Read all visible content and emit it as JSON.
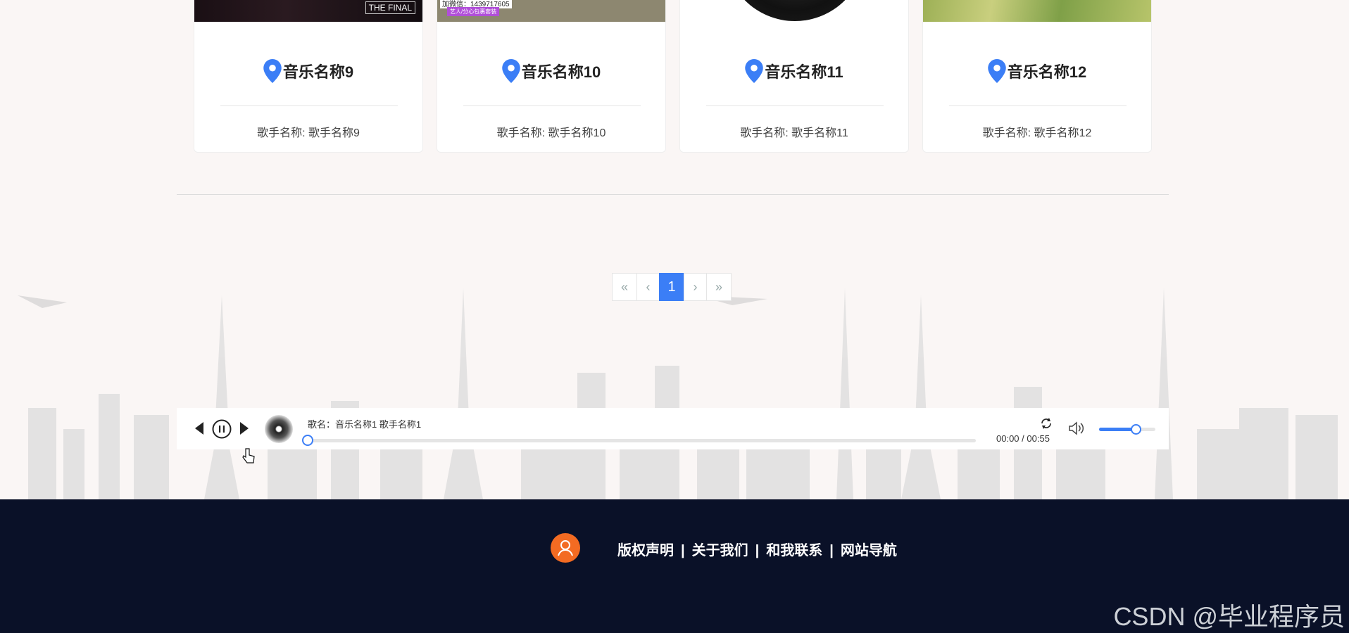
{
  "cards": [
    {
      "title": "音乐名称9",
      "singer_label": "歌手名称: ",
      "singer": "歌手名称9",
      "thumb_text": "THE FINAL"
    },
    {
      "title": "音乐名称10",
      "singer_label": "歌手名称: ",
      "singer": "歌手名称10",
      "thumb_text": "加微信：1439717605",
      "thumb_badge": "艺人/分心包裹套装"
    },
    {
      "title": "音乐名称11",
      "singer_label": "歌手名称: ",
      "singer": "歌手名称11"
    },
    {
      "title": "音乐名称12",
      "singer_label": "歌手名称: ",
      "singer": "歌手名称12"
    }
  ],
  "pagination": {
    "first": "«",
    "prev": "‹",
    "current": "1",
    "next": "›",
    "last": "»"
  },
  "player": {
    "song_text": "歌名：音乐名称1 歌手名称1",
    "current_time": "00:00",
    "duration": "00:55",
    "time_separator": " / ",
    "progress": 0,
    "volume": 0.65
  },
  "footer": {
    "links": [
      "版权声明",
      "关于我们",
      "和我联系",
      "网站导航"
    ],
    "separator": "|"
  },
  "watermark": "CSDN @毕业程序员",
  "colors": {
    "accent": "#3b7ef6",
    "footer_bg": "#0a1128",
    "avatar": "#f36b22"
  }
}
